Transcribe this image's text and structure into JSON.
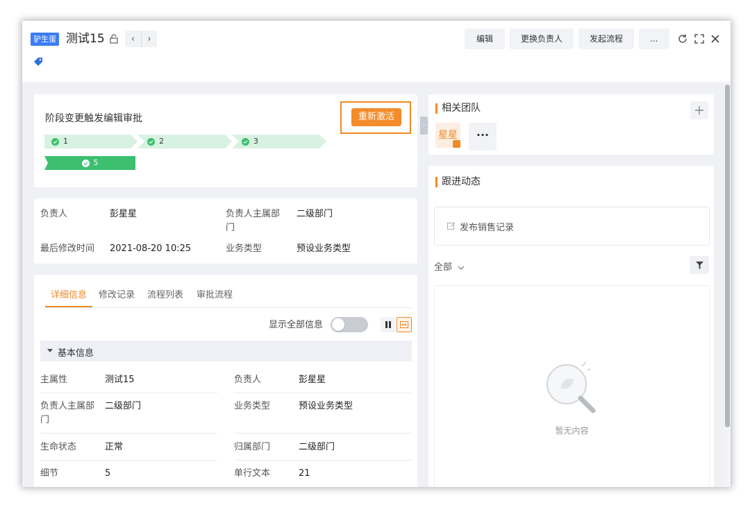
{
  "header": {
    "tag_badge": "驴生蛋",
    "title": "测试15",
    "nav_prev": "‹",
    "nav_next": "›",
    "buttons": {
      "edit": "编辑",
      "change_owner": "更换负责人",
      "start_flow": "发起流程",
      "more": "..."
    }
  },
  "stage_card": {
    "title": "阶段变更触发编辑审批",
    "reactivate": "重新激活",
    "stages": [
      "1",
      "2",
      "3",
      "5"
    ]
  },
  "summary": {
    "owner_label": "负责人",
    "owner_value": "彭星星",
    "dept_label_line1": "负责人主属部",
    "dept_label_line2": "门",
    "dept_value": "二级部门",
    "modified_label": "最后修改时间",
    "modified_value": "2021-08-20 10:25",
    "biztype_label": "业务类型",
    "biztype_value": "预设业务类型"
  },
  "tabs": [
    "详细信息",
    "修改记录",
    "流程列表",
    "审批流程"
  ],
  "show_all_label": "显示全部信息",
  "section": {
    "title": "基本信息",
    "fields": {
      "main_attr_label": "主属性",
      "main_attr_value": "测试15",
      "owner_label": "负责人",
      "owner_value": "彭星星",
      "dept_label_line1": "负责人主属部",
      "dept_label_line2": "门",
      "dept_value": "二级部门",
      "biztype_label": "业务类型",
      "biztype_value": "预设业务类型",
      "life_label": "生命状态",
      "life_value": "正常",
      "belong_label": "归属部门",
      "belong_value": "二级部门",
      "detail_label": "细节",
      "detail_value": "5",
      "single_text_label": "单行文本",
      "single_text_value": "21"
    }
  },
  "team": {
    "title": "相关团队",
    "member": "星星",
    "more": "···"
  },
  "followup": {
    "title": "跟进动态",
    "publish": "发布销售记录",
    "filter": "全部",
    "empty": "暂无内容"
  },
  "colors": {
    "accent": "#f08a24",
    "success": "#3cbf6f",
    "badge": "#3b7cf5"
  }
}
